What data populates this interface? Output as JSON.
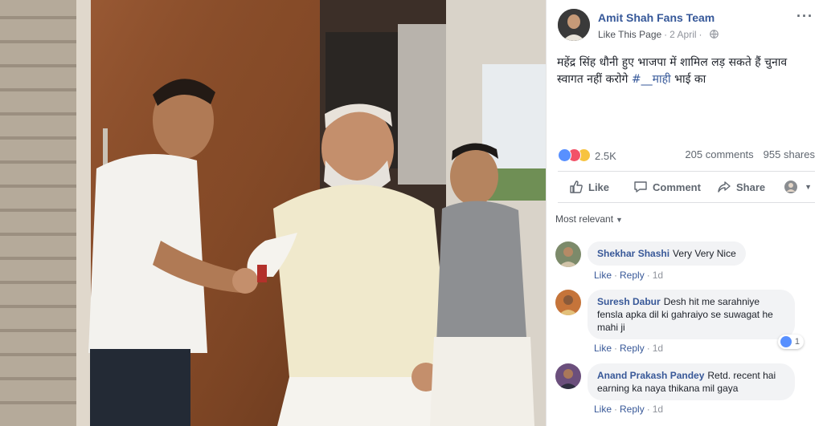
{
  "post": {
    "page_name": "Amit Shah Fans Team",
    "like_page": "Like This Page",
    "date": "2 April",
    "text_line1": "महेंद्र सिंह धौनी हुए भाजपा में शामिल लड़ सकते हैं चुनाव",
    "text_line2_pre": "स्वागत नहीं करोगे ",
    "hashtag": "#__माही",
    "text_line2_post": " भाई का",
    "reaction_count": "2.5K",
    "comments": "205 comments",
    "shares": "955 shares"
  },
  "actions": {
    "like": "Like",
    "comment": "Comment",
    "share": "Share"
  },
  "filter": {
    "label": "Most relevant"
  },
  "comments": [
    {
      "author": "Shekhar Shashi",
      "text": "Very Very Nice",
      "like": "Like",
      "reply": "Reply",
      "time": "1d"
    },
    {
      "author": "Suresh Dabur",
      "text": "Desh hit me sarahniye fensla apka dil ki gahraiyo se suwagat he mahi ji",
      "like": "Like",
      "reply": "Reply",
      "time": "1d",
      "reactions": "1"
    },
    {
      "author": "Anand Prakash Pandey",
      "text": "Retd. recent hai earning ka naya thikana mil gaya",
      "like": "Like",
      "reply": "Reply",
      "time": "1d"
    }
  ],
  "colors": {
    "link": "#365899",
    "muted": "#90949c",
    "bubble": "#f2f3f5",
    "like_blue": "#5890ff",
    "love_red": "#f25268",
    "wow_yellow": "#f7c340"
  }
}
